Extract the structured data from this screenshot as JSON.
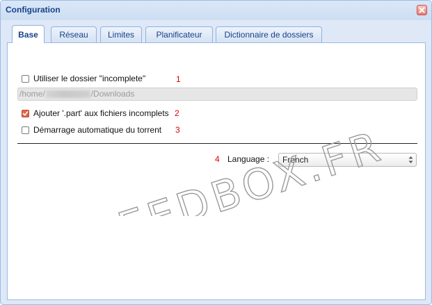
{
  "window": {
    "title": "Configuration"
  },
  "tabs": [
    {
      "label": "Base",
      "active": true
    },
    {
      "label": "Réseau",
      "active": false
    },
    {
      "label": "Limites",
      "active": false
    },
    {
      "label": "Planificateur",
      "active": false
    },
    {
      "label": "Dictionnaire de dossiers",
      "active": false
    }
  ],
  "base": {
    "incomplete_label": "Utiliser le dossier \"incomplete\"",
    "incomplete_checked": false,
    "incomplete_note": "1",
    "path_prefix": "/home/",
    "path_suffix": "/Downloads",
    "part_label": "Ajouter '.part' aux fichiers incomplets",
    "part_checked": true,
    "part_note": "2",
    "autostart_label": "Démarrage automatique du torrent",
    "autostart_checked": false,
    "autostart_note": "3",
    "language_note": "4",
    "language_label": "Language :",
    "language_value": "French"
  },
  "watermark": "SEEDBOX.FR",
  "colors": {
    "title": "#15428b",
    "accent": "#99bbe8",
    "annotation": "#e00000",
    "checked": "#e06a48"
  },
  "icons": {
    "close": "close-icon",
    "check": "checkmark-icon",
    "select": "updown-arrows-icon"
  }
}
